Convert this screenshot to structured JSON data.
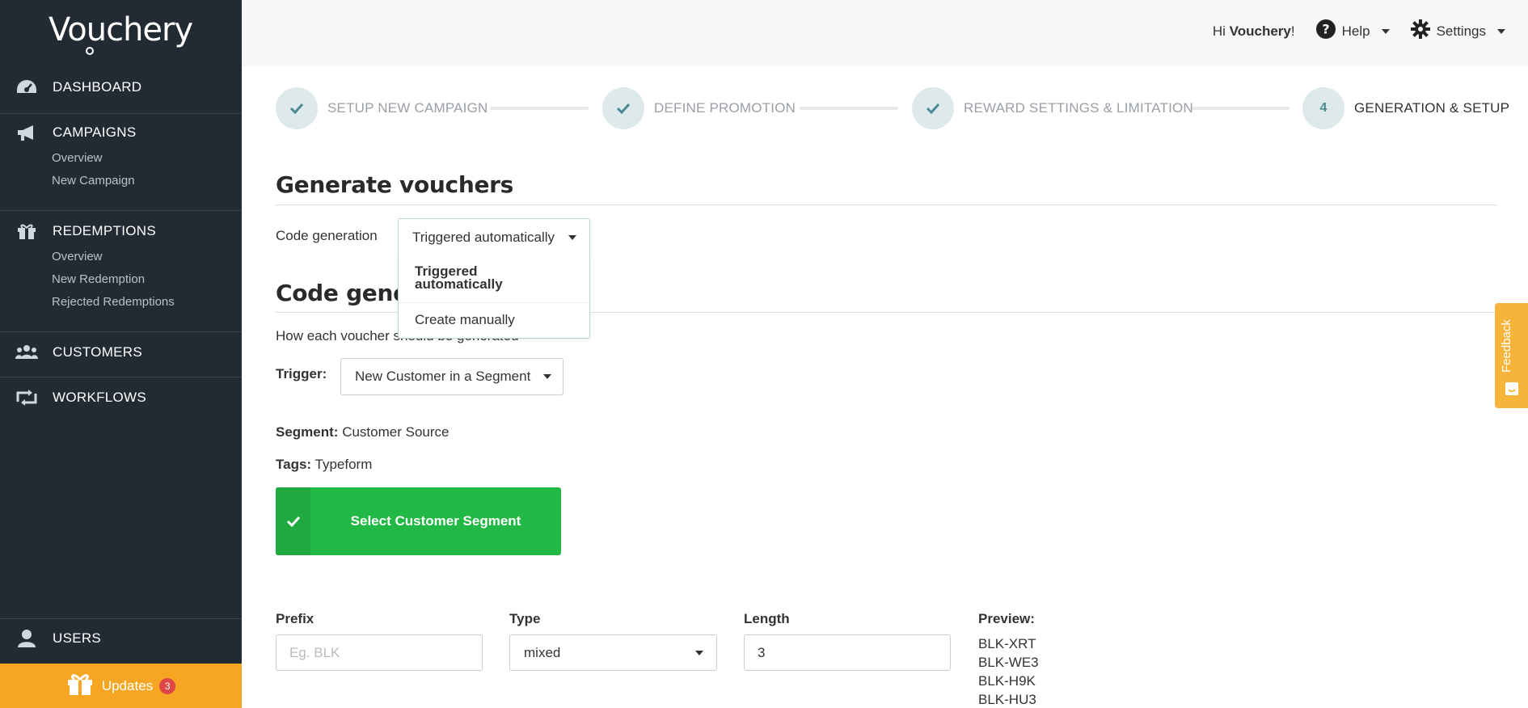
{
  "app": {
    "logo": "Vouchery"
  },
  "sidebar": {
    "dashboard": "DASHBOARD",
    "campaigns": {
      "label": "CAMPAIGNS",
      "items": [
        "Overview",
        "New Campaign"
      ]
    },
    "redemptions": {
      "label": "REDEMPTIONS",
      "items": [
        "Overview",
        "New Redemption",
        "Rejected Redemptions"
      ]
    },
    "customers": "CUSTOMERS",
    "workflows": "WORKFLOWS",
    "users": "USERS",
    "updates": {
      "label": "Updates",
      "count": "3"
    }
  },
  "topbar": {
    "greeting_prefix": "Hi ",
    "greeting_name": "Vouchery",
    "greeting_suffix": "!",
    "help": "Help",
    "settings": "Settings"
  },
  "steps": [
    {
      "label": "SETUP NEW CAMPAIGN",
      "status": "done"
    },
    {
      "label": "DEFINE PROMOTION",
      "status": "done"
    },
    {
      "label": "REWARD SETTINGS & LIMITATION",
      "status": "done"
    },
    {
      "number": "4",
      "label": "GENERATION & SETUP",
      "status": "active"
    }
  ],
  "generate": {
    "title": "Generate vouchers",
    "code_generation_label": "Code generation",
    "code_generation_value": "Triggered automatically",
    "options": [
      "Triggered automatically",
      "Create manually"
    ]
  },
  "code_section": {
    "title_visible": "Code gene",
    "description": "How each voucher should be generated",
    "trigger_label": "Trigger:",
    "trigger_value": "New Customer in a Segment",
    "segment_label": "Segment:",
    "segment_value": "Customer Source",
    "tags_label": "Tags:",
    "tags_value": "Typeform",
    "select_segment_button": "Select Customer Segment"
  },
  "code_format": {
    "prefix_label": "Prefix",
    "prefix_placeholder": "Eg. BLK",
    "type_label": "Type",
    "type_value": "mixed",
    "length_label": "Length",
    "length_value": "3",
    "preview_label": "Preview:",
    "preview": [
      "BLK-XRT",
      "BLK-WE3",
      "BLK-H9K",
      "BLK-HU3"
    ]
  },
  "feedback": "Feedback",
  "colors": {
    "sidebar_bg": "#222a33",
    "accent_green": "#22b845",
    "updates_orange": "#f6a623",
    "step_circle": "#dde9ea"
  }
}
